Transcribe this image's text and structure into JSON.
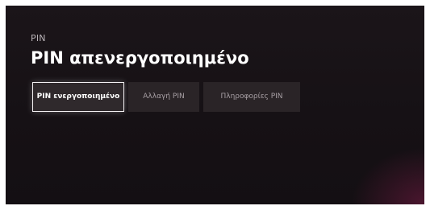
{
  "screen": {
    "section_label": "PIN",
    "title": "PIN απενεργοποιημένο"
  },
  "buttons": [
    {
      "label": "PIN ενεργοποιημένο",
      "state": "focused"
    },
    {
      "label": "Αλλαγή PIN",
      "state": "normal"
    },
    {
      "label": "Πληροφορίες PIN",
      "state": "normal"
    }
  ],
  "colors": {
    "background": "#161115",
    "button": "#2a2427",
    "focus_border": "#f4f1f3",
    "accent_glow": "#781c46"
  }
}
